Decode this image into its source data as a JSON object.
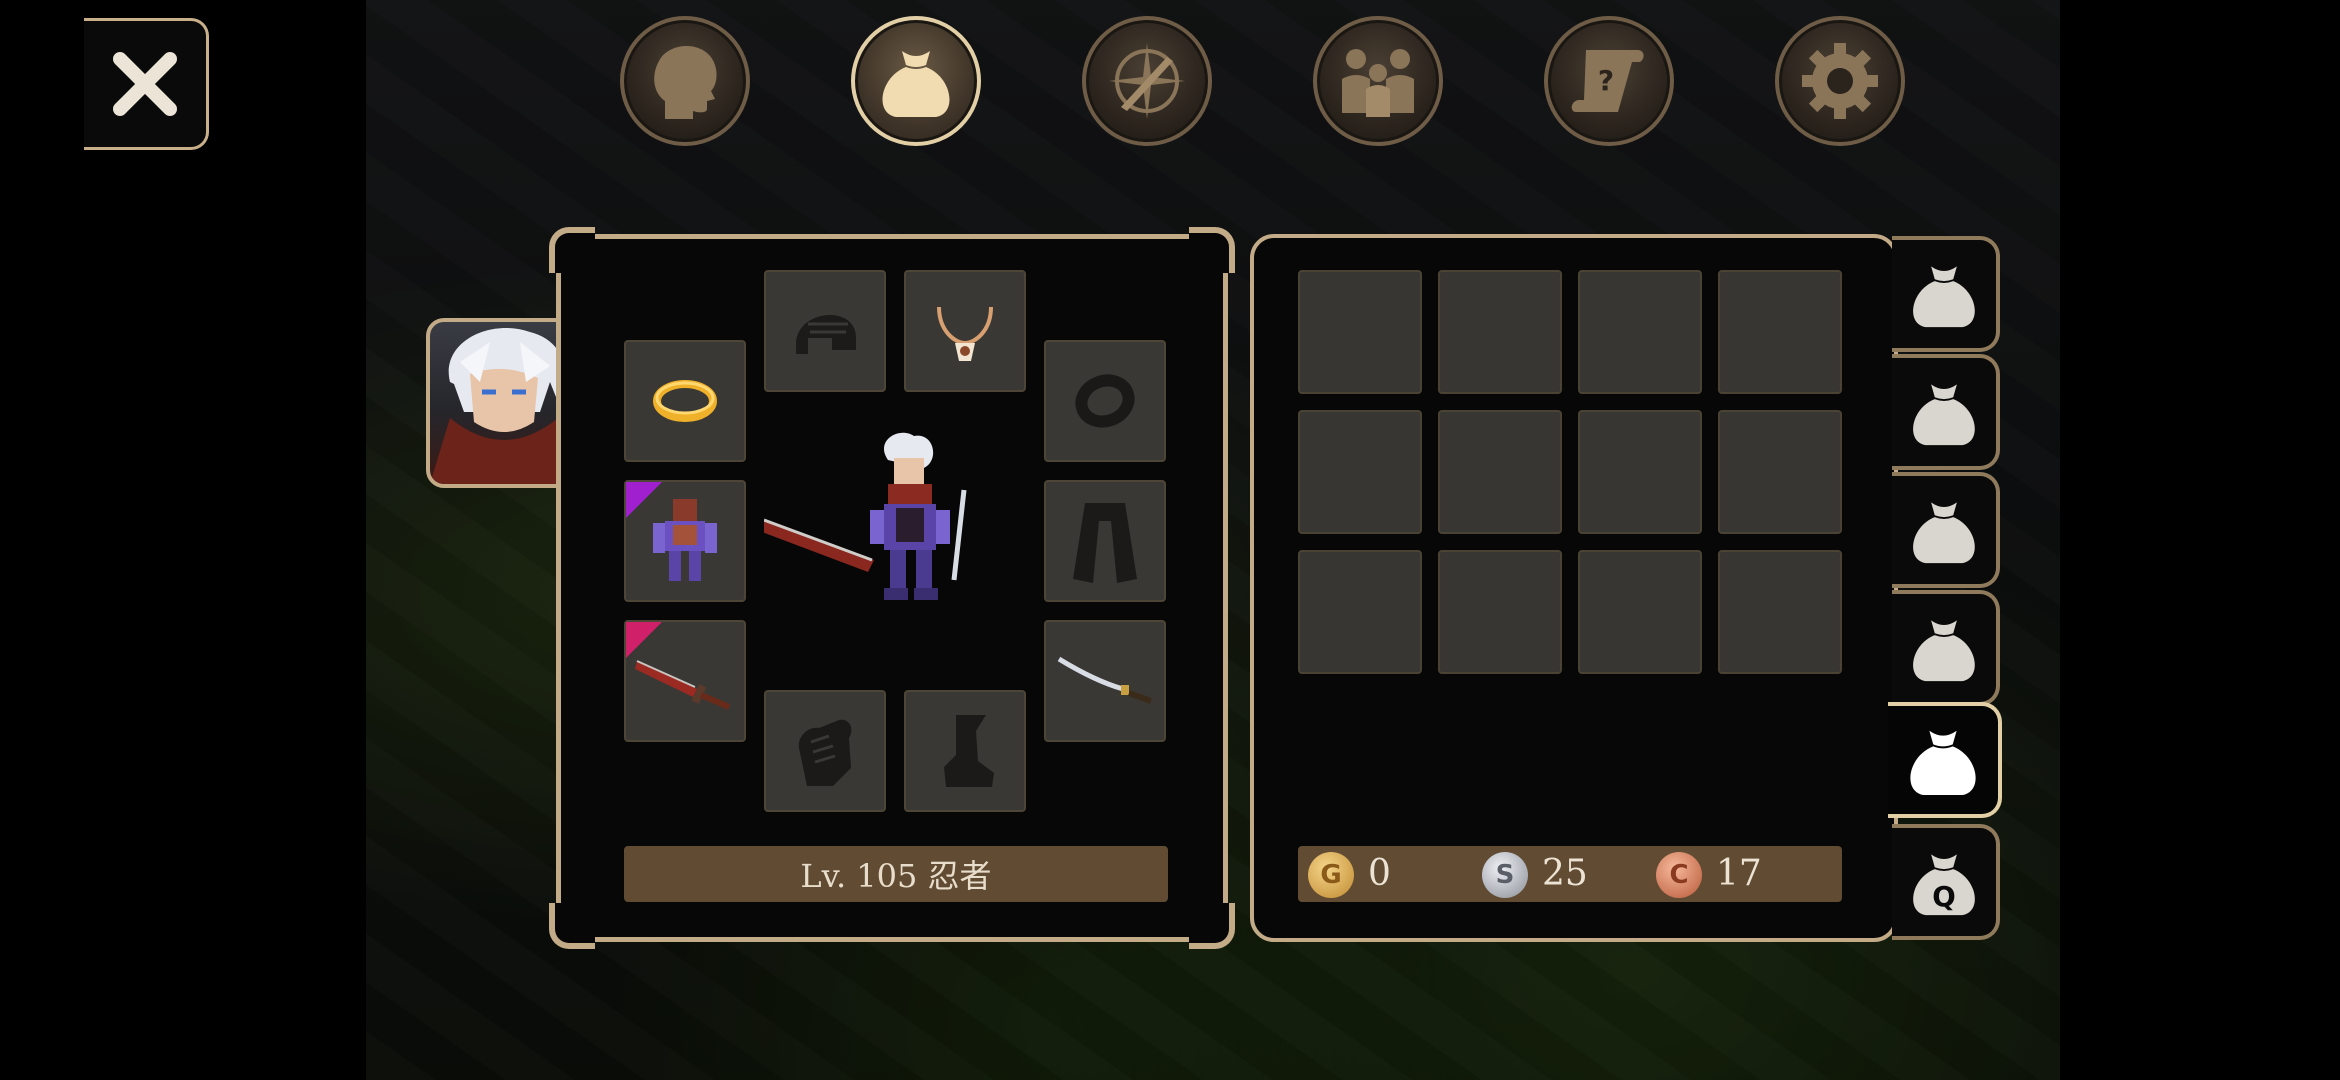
{
  "top_menu": [
    {
      "name": "character",
      "icon": "head-icon"
    },
    {
      "name": "inventory",
      "icon": "bag-icon",
      "active": true
    },
    {
      "name": "skills",
      "icon": "sword-compass-icon"
    },
    {
      "name": "party",
      "icon": "people-icon"
    },
    {
      "name": "quests",
      "icon": "scroll-icon"
    },
    {
      "name": "settings",
      "icon": "gear-icon"
    }
  ],
  "equipment": {
    "level_label": "Lv. 105 忍者",
    "slots": {
      "helmet": {
        "icon": "helmet-icon",
        "equipped": false
      },
      "necklace": {
        "icon": "necklace-icon",
        "equipped": true
      },
      "ring_left": {
        "icon": "ring-icon",
        "equipped": true
      },
      "ring_right": {
        "icon": "ring-empty-icon",
        "equipped": false
      },
      "armor": {
        "icon": "armor-icon",
        "equipped": true,
        "rarity_color": "#a020d0"
      },
      "cloak": {
        "icon": "cloak-icon",
        "equipped": false
      },
      "weapon_main": {
        "icon": "greatsword-icon",
        "equipped": true,
        "rarity_color": "#d0206a"
      },
      "weapon_off": {
        "icon": "katana-icon",
        "equipped": true
      },
      "gloves": {
        "icon": "gloves-icon",
        "equipped": false
      },
      "boots": {
        "icon": "boots-icon",
        "equipped": false
      }
    }
  },
  "inventory": {
    "rows": 3,
    "cols": 4,
    "currency": {
      "gold": {
        "symbol": "G",
        "value": "0",
        "color": "#d9a84a"
      },
      "silver": {
        "symbol": "S",
        "value": "25",
        "color": "#b9bcc2"
      },
      "copper": {
        "symbol": "C",
        "value": "17",
        "color": "#d77b5a"
      }
    }
  },
  "bag_tabs": [
    {
      "name": "bag-1"
    },
    {
      "name": "bag-2"
    },
    {
      "name": "bag-3"
    },
    {
      "name": "bag-4"
    },
    {
      "name": "bag-5",
      "active": true
    },
    {
      "name": "quest-bag",
      "label": "Q"
    }
  ],
  "colors": {
    "frame": "#c3ab88",
    "bar": "#614c33",
    "slot": "#3a3835"
  }
}
